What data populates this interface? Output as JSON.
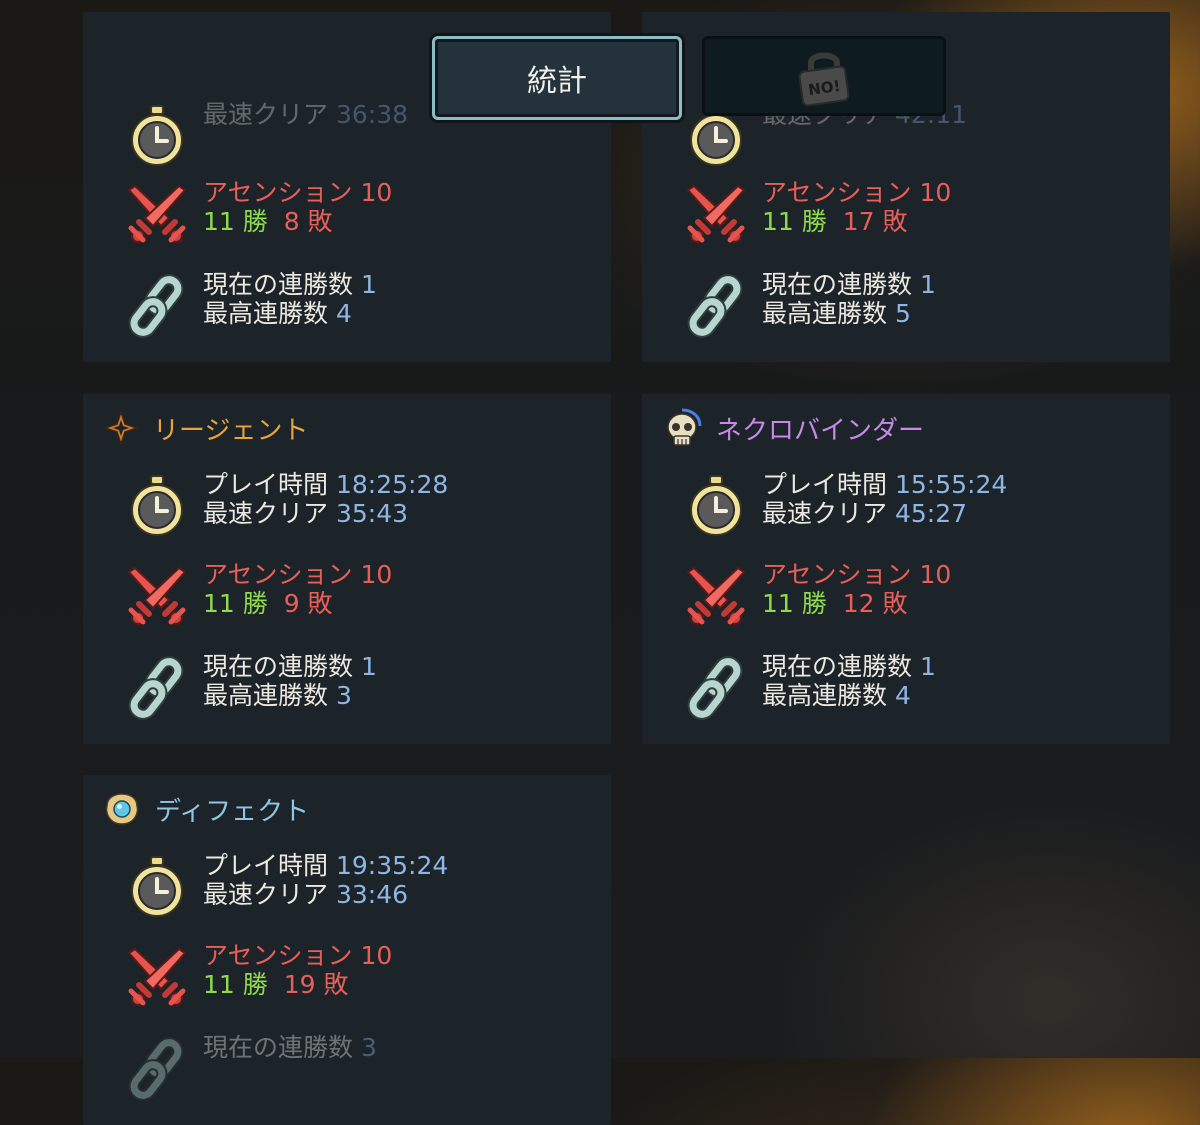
{
  "tabs": {
    "stats_label": "統計",
    "locked_label": "NO!"
  },
  "labels": {
    "play_time": "プレイ時間",
    "fastest_clear": "最速クリア",
    "ascension": "アセンション",
    "wins_suffix": "勝",
    "losses_suffix": "敗",
    "current_streak": "現在の連勝数",
    "best_streak": "最高連勝数"
  },
  "cards": [
    {
      "name": "",
      "fastest_clear": "36:38",
      "ascension": "10",
      "wins": "11",
      "losses": "8",
      "current_streak": "1",
      "best_streak": "4"
    },
    {
      "name": "",
      "fastest_clear": "42:11",
      "ascension": "10",
      "wins": "11",
      "losses": "17",
      "current_streak": "1",
      "best_streak": "5"
    },
    {
      "name": "リージェント",
      "name_color": "#e8a33c",
      "icon": "regent-star-icon",
      "play_time": "18:25:28",
      "fastest_clear": "35:43",
      "ascension": "10",
      "wins": "11",
      "losses": "9",
      "current_streak": "1",
      "best_streak": "3"
    },
    {
      "name": "ネクロバインダー",
      "name_color": "#c889e6",
      "icon": "skull-icon",
      "play_time": "15:55:24",
      "fastest_clear": "45:27",
      "ascension": "10",
      "wins": "11",
      "losses": "12",
      "current_streak": "1",
      "best_streak": "4"
    },
    {
      "name": "ディフェクト",
      "name_color": "#8dc7e4",
      "icon": "orb-icon",
      "play_time": "19:35:24",
      "fastest_clear": "33:46",
      "ascension": "10",
      "wins": "11",
      "losses": "19",
      "current_streak": "3"
    }
  ],
  "colors": {
    "value_blue": "#8db6e4",
    "ascension_red": "#e95e56",
    "wins_green": "#8fdb4d",
    "card_bg": "#1c2329"
  }
}
